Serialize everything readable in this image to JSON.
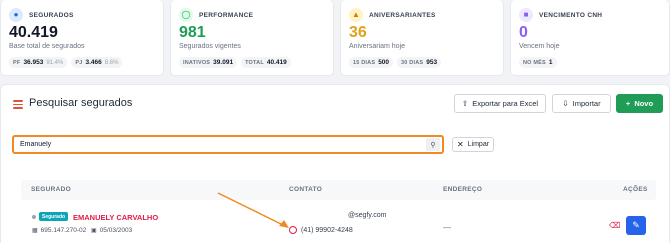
{
  "stats": {
    "segurados": {
      "label": "SEGURADOS",
      "value": "40.419",
      "subtitle": "Base total de segurados",
      "chips": [
        {
          "label": "PF",
          "value": "36.953",
          "pct": "91.4%"
        },
        {
          "label": "PJ",
          "value": "3.466",
          "pct": "8.6%"
        }
      ]
    },
    "performance": {
      "label": "PERFORMANCE",
      "value": "981",
      "subtitle": "Segurados vigentes",
      "chips": [
        {
          "label": "INATIVOS",
          "value": "39.091"
        },
        {
          "label": "TOTAL",
          "value": "40.419"
        }
      ]
    },
    "aniversariantes": {
      "label": "ANIVERSARIANTES",
      "value": "36",
      "subtitle": "Aniversariam hoje",
      "chips": [
        {
          "label": "15 DIAS",
          "value": "500"
        },
        {
          "label": "30 DIAS",
          "value": "953"
        }
      ]
    },
    "cnh": {
      "label": "VENCIMENTO CNH",
      "value": "0",
      "subtitle": "Vencem hoje",
      "chips": [
        {
          "label": "NO MÊS",
          "value": "1"
        }
      ]
    }
  },
  "colors": {
    "segurados": "#1f2937",
    "performance": "#1f9d57",
    "aniversariantes": "#e0a21a",
    "cnh": "#8b5cf6",
    "accent_orange": "#f08a24",
    "primary_green": "#1f9d57",
    "edit_blue": "#2563eb",
    "name_red": "#e11d48"
  },
  "panel": {
    "title": "Pesquisar segurados",
    "export_label": "Exportar para Excel",
    "import_label": "Importar",
    "new_label": "Novo"
  },
  "search": {
    "value": "Emanuely",
    "placeholder": "",
    "clear_label": "Limpar"
  },
  "table": {
    "headers": {
      "segurado": "SEGURADO",
      "contato": "CONTATO",
      "endereco": "ENDEREÇO",
      "acoes": "AÇÕES"
    },
    "rows": [
      {
        "badge": "Segurado",
        "name": "EMANUELY CARVALHO",
        "document": "695.147.270-02",
        "birthdate": "05/03/2003",
        "email": "@segfy.com",
        "phone": "(41) 99902-4248",
        "address": "—"
      }
    ]
  },
  "icons": {
    "segurados": "users-icon",
    "performance": "target-icon",
    "aniversariantes": "cake-icon",
    "cnh": "id-card-icon"
  }
}
